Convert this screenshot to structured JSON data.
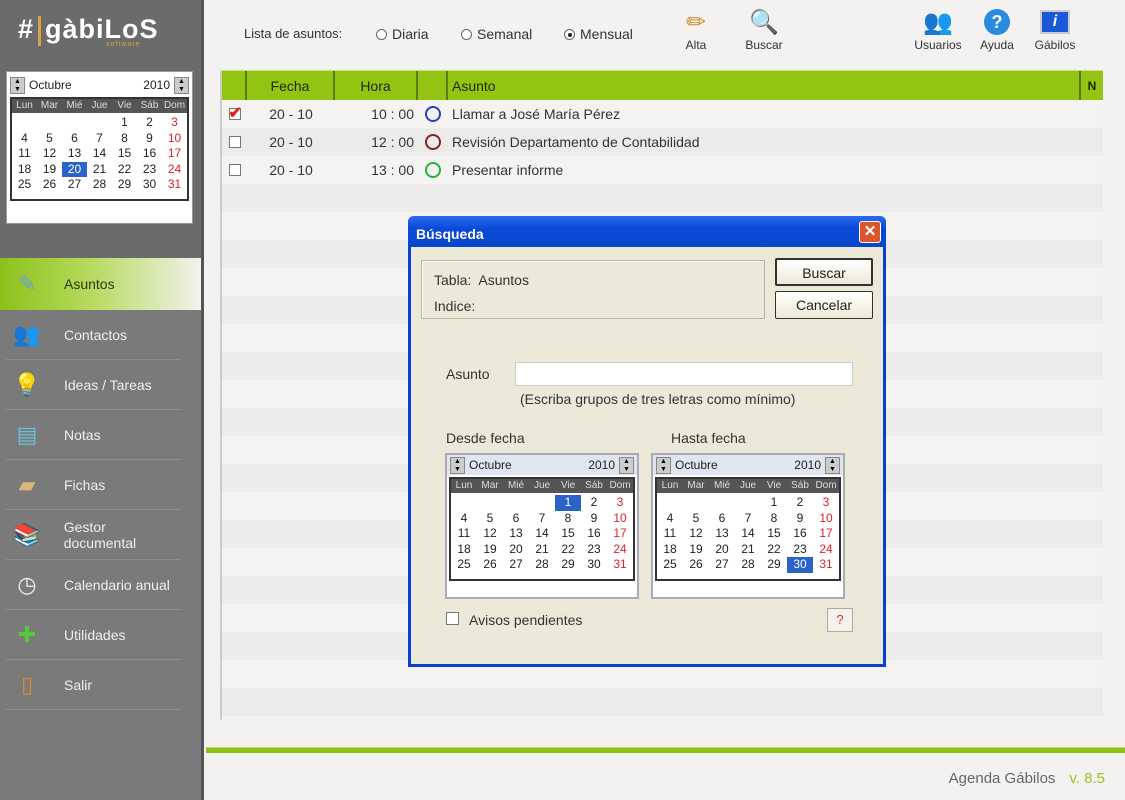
{
  "logo": {
    "text": "gàbiLoS",
    "sub": "software"
  },
  "mini_calendar": {
    "month": "Octubre",
    "year": "2010",
    "weekdays": [
      "Lun",
      "Mar",
      "Mié",
      "Jue",
      "Vie",
      "Sáb",
      "Dom"
    ],
    "selected_day": 20
  },
  "sidebar": {
    "items": [
      {
        "label": "Asuntos",
        "icon": "asuntos-icon",
        "active": true
      },
      {
        "label": "Contactos",
        "icon": "contactos-icon"
      },
      {
        "label": "Ideas / Tareas",
        "icon": "lightbulb-icon"
      },
      {
        "label": "Notas",
        "icon": "notas-icon"
      },
      {
        "label": "Fichas",
        "icon": "fichas-icon"
      },
      {
        "label": "Gestor documental",
        "icon": "books-icon"
      },
      {
        "label": "Calendario anual",
        "icon": "clock-icon"
      },
      {
        "label": "Utilidades",
        "icon": "plus-icon"
      },
      {
        "label": "Salir",
        "icon": "exit-door-icon"
      }
    ]
  },
  "toolbar": {
    "lista_label": "Lista de asuntos:",
    "radios": [
      {
        "label": "Diaria",
        "checked": false
      },
      {
        "label": "Semanal",
        "checked": false
      },
      {
        "label": "Mensual",
        "checked": true
      }
    ],
    "buttons": [
      {
        "label": "Alta",
        "icon": "pencil-icon"
      },
      {
        "label": "Buscar",
        "icon": "search-doc-icon"
      },
      {
        "label": "Usuarios",
        "icon": "users-icon"
      },
      {
        "label": "Ayuda",
        "icon": "help-icon"
      },
      {
        "label": "Gábilos",
        "icon": "info-monitor-icon"
      }
    ]
  },
  "grid": {
    "columns": [
      "",
      "Fecha",
      "Hora",
      "",
      "Asunto",
      "N"
    ],
    "rows": [
      {
        "checked": true,
        "fecha": "20 - 10",
        "hora": "10 : 00",
        "status_color": "#2a3fc8",
        "asunto": "Llamar a José María Pérez"
      },
      {
        "checked": false,
        "fecha": "20 - 10",
        "hora": "12 : 00",
        "status_color": "#8a1f1f",
        "asunto": "Revisión Departamento de Contabilidad"
      },
      {
        "checked": false,
        "fecha": "20 - 10",
        "hora": "13 : 00",
        "status_color": "#22b33a",
        "asunto": "Presentar informe"
      }
    ]
  },
  "dialog": {
    "title": "Búsqueda",
    "tabla_label": "Tabla:",
    "tabla_value": "Asuntos",
    "indice_label": "Indice:",
    "buscar": "Buscar",
    "cancelar": "Cancelar",
    "asunto_label": "Asunto",
    "asunto_value": "",
    "hint": "(Escriba grupos de tres letras como mínimo)",
    "desde_label": "Desde fecha",
    "hasta_label": "Hasta fecha",
    "desde": {
      "month": "Octubre",
      "year": "2010",
      "selected_day": 1
    },
    "hasta": {
      "month": "Octubre",
      "year": "2010",
      "selected_day": 30
    },
    "avisos_label": "Avisos pendientes",
    "avisos_checked": false,
    "help_button": "?"
  },
  "footer": {
    "app": "Agenda Gábilos",
    "version": "v. 8.5"
  },
  "colors": {
    "accent_green": "#94c413",
    "dialog_blue": "#0a4ad8",
    "sunday_red": "#e0202a",
    "selected_blue": "#2a63c9"
  }
}
